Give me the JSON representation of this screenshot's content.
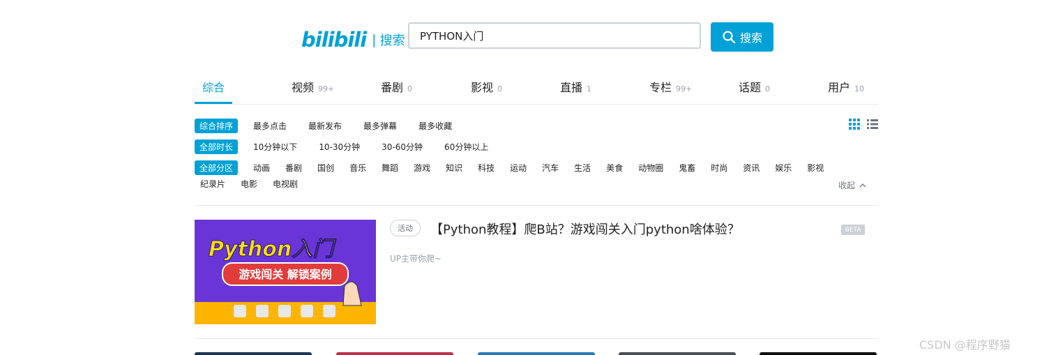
{
  "header": {
    "logo_word": "bilibili",
    "logo_sub": "搜索",
    "search_value": "PYTHON入门",
    "search_button_label": "搜索"
  },
  "tabs": [
    {
      "label": "综合",
      "count": ""
    },
    {
      "label": "视频",
      "count": "99+"
    },
    {
      "label": "番剧",
      "count": "0"
    },
    {
      "label": "影视",
      "count": "0"
    },
    {
      "label": "直播",
      "count": "1"
    },
    {
      "label": "专栏",
      "count": "99+"
    },
    {
      "label": "话题",
      "count": "0"
    },
    {
      "label": "用户",
      "count": "10"
    }
  ],
  "filters": {
    "sort": {
      "active": "综合排序",
      "options": [
        "最多点击",
        "最新发布",
        "最多弹幕",
        "最多收藏"
      ]
    },
    "duration": {
      "active": "全部时长",
      "options": [
        "10分钟以下",
        "10-30分钟",
        "30-60分钟",
        "60分钟以上"
      ]
    },
    "zone": {
      "active": "全部分区",
      "options": [
        "动画",
        "番剧",
        "国创",
        "音乐",
        "舞蹈",
        "游戏",
        "知识",
        "科技",
        "运动",
        "汽车",
        "生活",
        "美食",
        "动物圈",
        "鬼畜",
        "时尚",
        "资讯",
        "娱乐",
        "影视"
      ],
      "options_row2": [
        "纪录片",
        "电影",
        "电视剧"
      ]
    },
    "collapse_label": "收起"
  },
  "result": {
    "badge": "活动",
    "title": "【Python教程】爬B站？游戏闯关入门python啥体验？",
    "beta": "BETA",
    "desc": "UP主带你爬~",
    "thumb": {
      "line1": "Python入门",
      "line2": "游戏闯关  解锁案例"
    }
  },
  "watermark": "CSDN @程序野猫",
  "colors": {
    "accent": "#00a1d6",
    "muted": "#99a2aa",
    "thumb_bg": "#6a35d6",
    "thumb_text": "#ffe100"
  }
}
